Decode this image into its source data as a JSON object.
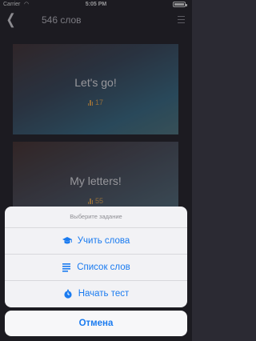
{
  "status_bar": {
    "carrier": "Carrier",
    "time": "5:05 PM"
  },
  "nav": {
    "title": "546 слов"
  },
  "cards": [
    {
      "name": "Let's go!",
      "count": "17"
    },
    {
      "name": "My letters!",
      "count": "55"
    }
  ],
  "action_sheet": {
    "header": "Выберите задание",
    "options": [
      {
        "label": "Учить слова",
        "icon": "graduation-cap-icon"
      },
      {
        "label": "Список слов",
        "icon": "list-icon"
      },
      {
        "label": "Начать тест",
        "icon": "stopwatch-icon"
      }
    ],
    "cancel": "Отмена"
  },
  "colors": {
    "accent": "#1a7bf0",
    "count": "#e0a85a",
    "background": "#2b2a33"
  }
}
